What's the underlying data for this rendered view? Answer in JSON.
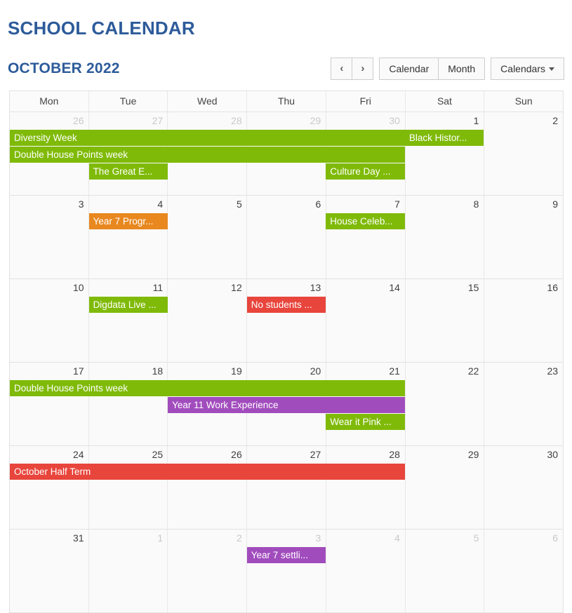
{
  "page_title": "SCHOOL CALENDAR",
  "toolbar": {
    "month_title": "OCTOBER 2022",
    "prev_label": "‹",
    "next_label": "›",
    "calendar_label": "Calendar",
    "month_label": "Month",
    "calendars_label": "Calendars"
  },
  "colors": {
    "title_blue": "#2d5b9a",
    "green": "#7fba09",
    "orange": "#e8881f",
    "red": "#e8453c",
    "purple": "#a14cbd",
    "grid_border": "#e2e2e2",
    "cell_bg": "#fafafa",
    "other_month_text": "#c9c9c9"
  },
  "day_headers": [
    "Mon",
    "Tue",
    "Wed",
    "Thu",
    "Fri",
    "Sat",
    "Sun"
  ],
  "weeks": [
    {
      "dates": [
        {
          "n": "26",
          "other": true
        },
        {
          "n": "27",
          "other": true
        },
        {
          "n": "28",
          "other": true
        },
        {
          "n": "29",
          "other": true
        },
        {
          "n": "30",
          "other": true
        },
        {
          "n": "1",
          "other": false
        },
        {
          "n": "2",
          "other": false
        }
      ],
      "rows": [
        [
          {
            "label": "Diversity Week",
            "color": "#7fba09",
            "start": 0,
            "span": 5
          },
          {
            "label": "Black Histor...",
            "color": "#7fba09",
            "start": 5,
            "span": 1
          }
        ],
        [
          {
            "label": "Double House Points week",
            "color": "#7fba09",
            "start": 0,
            "span": 5
          }
        ],
        [
          {
            "label": "The Great E...",
            "color": "#7fba09",
            "start": 1,
            "span": 1
          },
          {
            "label": "Culture Day ...",
            "color": "#7fba09",
            "start": 4,
            "span": 1
          }
        ]
      ],
      "filler": 0
    },
    {
      "dates": [
        {
          "n": "3",
          "other": false
        },
        {
          "n": "4",
          "other": false
        },
        {
          "n": "5",
          "other": false
        },
        {
          "n": "6",
          "other": false
        },
        {
          "n": "7",
          "other": false
        },
        {
          "n": "8",
          "other": false
        },
        {
          "n": "9",
          "other": false
        }
      ],
      "rows": [
        [
          {
            "label": "Year 7 Progr...",
            "color": "#e8881f",
            "start": 1,
            "span": 1
          },
          {
            "label": "House Celeb...",
            "color": "#7fba09",
            "start": 4,
            "span": 1
          }
        ]
      ],
      "filler": 2
    },
    {
      "dates": [
        {
          "n": "10",
          "other": false
        },
        {
          "n": "11",
          "other": false
        },
        {
          "n": "12",
          "other": false
        },
        {
          "n": "13",
          "other": false
        },
        {
          "n": "14",
          "other": false
        },
        {
          "n": "15",
          "other": false
        },
        {
          "n": "16",
          "other": false
        }
      ],
      "rows": [
        [
          {
            "label": "Digdata Live ...",
            "color": "#7fba09",
            "start": 1,
            "span": 1
          },
          {
            "label": "No students ...",
            "color": "#e8453c",
            "start": 3,
            "span": 1
          }
        ]
      ],
      "filler": 2
    },
    {
      "dates": [
        {
          "n": "17",
          "other": false
        },
        {
          "n": "18",
          "other": false
        },
        {
          "n": "19",
          "other": false
        },
        {
          "n": "20",
          "other": false
        },
        {
          "n": "21",
          "other": false
        },
        {
          "n": "22",
          "other": false
        },
        {
          "n": "23",
          "other": false
        }
      ],
      "rows": [
        [
          {
            "label": "Double House Points week",
            "color": "#7fba09",
            "start": 0,
            "span": 5
          }
        ],
        [
          {
            "label": "Year 11 Work Experience",
            "color": "#a14cbd",
            "start": 2,
            "span": 3
          }
        ],
        [
          {
            "label": "Wear it Pink ...",
            "color": "#7fba09",
            "start": 4,
            "span": 1
          }
        ]
      ],
      "filler": 0
    },
    {
      "dates": [
        {
          "n": "24",
          "other": false
        },
        {
          "n": "25",
          "other": false
        },
        {
          "n": "26",
          "other": false
        },
        {
          "n": "27",
          "other": false
        },
        {
          "n": "28",
          "other": false
        },
        {
          "n": "29",
          "other": false
        },
        {
          "n": "30",
          "other": false
        }
      ],
      "rows": [
        [
          {
            "label": "October Half Term",
            "color": "#e8453c",
            "start": 0,
            "span": 5
          }
        ]
      ],
      "filler": 2
    },
    {
      "dates": [
        {
          "n": "31",
          "other": false
        },
        {
          "n": "1",
          "other": true
        },
        {
          "n": "2",
          "other": true
        },
        {
          "n": "3",
          "other": true
        },
        {
          "n": "4",
          "other": true
        },
        {
          "n": "5",
          "other": true
        },
        {
          "n": "6",
          "other": true
        }
      ],
      "rows": [
        [
          {
            "label": "Year 7 settli...",
            "color": "#a14cbd",
            "start": 3,
            "span": 1
          }
        ]
      ],
      "filler": 2
    }
  ]
}
